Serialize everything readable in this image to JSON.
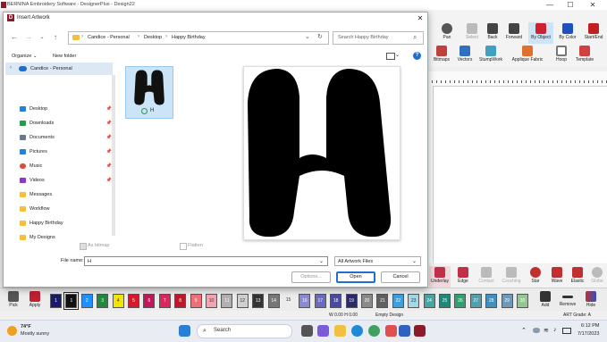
{
  "app": {
    "title": "BERNINA Embroidery Software - DesignerPlus - Design22",
    "window_controls": [
      "—",
      "☐",
      "✕"
    ]
  },
  "ribbon": {
    "row1": [
      {
        "label": "Pan",
        "icon": "hand-icon"
      },
      {
        "label": "Select",
        "icon": "select-icon"
      },
      {
        "label": "Back",
        "icon": "back-icon"
      },
      {
        "label": "Forward",
        "icon": "forward-icon"
      },
      {
        "label": "By Object",
        "icon": "by-object-icon"
      },
      {
        "label": "By Color",
        "icon": "by-color-icon"
      },
      {
        "label": "Start/End",
        "icon": "start-end-icon"
      }
    ],
    "row2": [
      {
        "label": "Bitmaps",
        "icon": "bitmaps-icon"
      },
      {
        "label": "Vectors",
        "icon": "vectors-icon"
      },
      {
        "label": "StumpWork",
        "icon": "stumpwork-icon"
      },
      {
        "label": "Applique Fabric",
        "icon": "applique-icon"
      },
      {
        "label": "Hoop",
        "icon": "hoop-icon"
      },
      {
        "label": "Template",
        "icon": "template-icon"
      }
    ]
  },
  "stitch_bar": [
    "Underlay",
    "Edge",
    "Contact",
    "Couching",
    "Star",
    "Wave",
    "Elastic",
    "Globe"
  ],
  "color_bar": {
    "pick_label": "Pick",
    "apply_label": "Apply",
    "swatches": [
      {
        "n": "1",
        "c": "#1a1a6e"
      },
      {
        "n": "1",
        "c": "#111111"
      },
      {
        "n": "2",
        "c": "#1e90ff"
      },
      {
        "n": "3",
        "c": "#1e8a3a"
      },
      {
        "n": "4",
        "c": "#f2e600"
      },
      {
        "n": "5",
        "c": "#d8192b"
      },
      {
        "n": "6",
        "c": "#c2185b"
      },
      {
        "n": "7",
        "c": "#e0245e"
      },
      {
        "n": "8",
        "c": "#c0182b"
      },
      {
        "n": "9",
        "c": "#f07078"
      },
      {
        "n": "10",
        "c": "#f6a3b0"
      },
      {
        "n": "11",
        "c": "#b0b0b0"
      },
      {
        "n": "12",
        "c": "#cfcfcf"
      },
      {
        "n": "13",
        "c": "#333333"
      },
      {
        "n": "14",
        "c": "#777777"
      },
      {
        "n": "15",
        "c": "#f5f5f5"
      },
      {
        "n": "16",
        "c": "#8a8ad0"
      },
      {
        "n": "17",
        "c": "#6a6ac0"
      },
      {
        "n": "18",
        "c": "#4a4aa0"
      },
      {
        "n": "19",
        "c": "#2a2a6a"
      },
      {
        "n": "20",
        "c": "#8a8a8a"
      },
      {
        "n": "21",
        "c": "#606060"
      },
      {
        "n": "22",
        "c": "#3aa0e0"
      },
      {
        "n": "23",
        "c": "#a0d8e8"
      },
      {
        "n": "24",
        "c": "#40a8a0"
      },
      {
        "n": "25",
        "c": "#208878"
      },
      {
        "n": "26",
        "c": "#30a070"
      },
      {
        "n": "27",
        "c": "#50a0b0"
      },
      {
        "n": "28",
        "c": "#4090c0"
      },
      {
        "n": "29",
        "c": "#7098b8"
      },
      {
        "n": "30",
        "c": "#90c890"
      }
    ],
    "add_label": "Add",
    "remove_label": "Remove",
    "hide_label": "Hide"
  },
  "status_bar": {
    "dims": "W 0.00 H 0.00",
    "design": "Empty Design",
    "grade": "ART Grade: A"
  },
  "taskbar": {
    "weather_temp": "74°F",
    "weather_desc": "Mostly sunny",
    "search_placeholder": "Search",
    "time": "6:12 PM",
    "date": "7/17/2023"
  },
  "dialog": {
    "title": "Insert Artwork",
    "breadcrumb": [
      "Candice - Personal",
      "Desktop",
      "Happy Birthday"
    ],
    "search_placeholder": "Search Happy Birthday",
    "organize_label": "Organize",
    "new_folder_label": "New folder",
    "sidebar_header": "Candice - Personal",
    "sidebar_items": [
      {
        "label": "Desktop",
        "icon": "desktop-icon",
        "color": "#2a7fd4",
        "pinned": true
      },
      {
        "label": "Downloads",
        "icon": "downloads-icon",
        "color": "#2a9a4a",
        "pinned": true
      },
      {
        "label": "Documents",
        "icon": "documents-icon",
        "color": "#6a7a8a",
        "pinned": true
      },
      {
        "label": "Pictures",
        "icon": "pictures-icon",
        "color": "#2a7fd4",
        "pinned": true
      },
      {
        "label": "Music",
        "icon": "music-icon",
        "color": "#e04a3a",
        "pinned": true
      },
      {
        "label": "Videos",
        "icon": "videos-icon",
        "color": "#8a3ac0",
        "pinned": true
      },
      {
        "label": "Messages",
        "icon": "folder-icon",
        "color": "#f0c040",
        "pinned": false
      },
      {
        "label": "Workflow",
        "icon": "folder-icon",
        "color": "#f0c040",
        "pinned": false
      },
      {
        "label": "Happy Birthday",
        "icon": "folder-icon",
        "color": "#f0c040",
        "pinned": false
      },
      {
        "label": "My Designs",
        "icon": "folder-icon",
        "color": "#f0c040",
        "pinned": false
      }
    ],
    "file_name_tile": "H",
    "as_bitmap_label": "As bitmap",
    "flatten_label": "Flatten",
    "file_name_label": "File name:",
    "file_name_value": "H",
    "file_type_value": "All Artwork Files",
    "options_label": "Options...",
    "open_label": "Open",
    "cancel_label": "Cancel"
  }
}
